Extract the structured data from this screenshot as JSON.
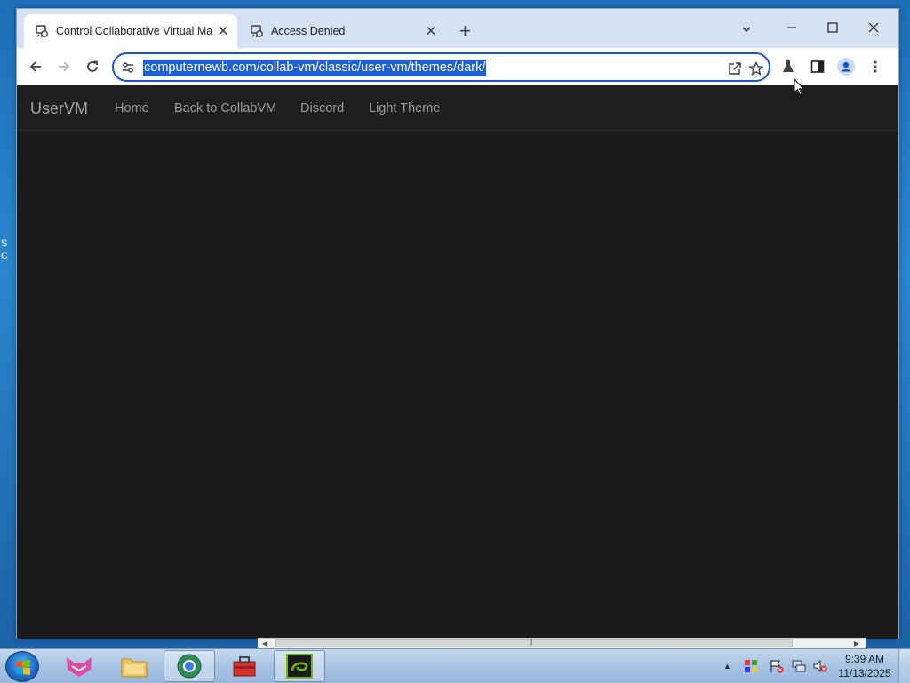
{
  "desktop": {
    "fragment_1": "S",
    "fragment_2": "C"
  },
  "browser": {
    "tabs": [
      {
        "title": "Control Collaborative Virtual Ma",
        "close": "✕",
        "active": true
      },
      {
        "title": "Access Denied",
        "close": "✕",
        "active": false
      }
    ],
    "new_tab": "+",
    "address_bar": {
      "url": "computernewb.com/collab-vm/classic/user-vm/themes/dark/"
    }
  },
  "page": {
    "brand": "UserVM",
    "nav": [
      "Home",
      "Back to CollabVM",
      "Discord",
      "Light Theme"
    ],
    "background_color": "#1b1b1b"
  },
  "taskbar": {
    "clock_time": "9:39 AM",
    "clock_date": "11/13/2025",
    "tray_arrow": "▲"
  },
  "colors": {
    "accent": "#1a56c7",
    "url_highlight": "#1e5fd4",
    "navbar": "#1e1e1e"
  }
}
